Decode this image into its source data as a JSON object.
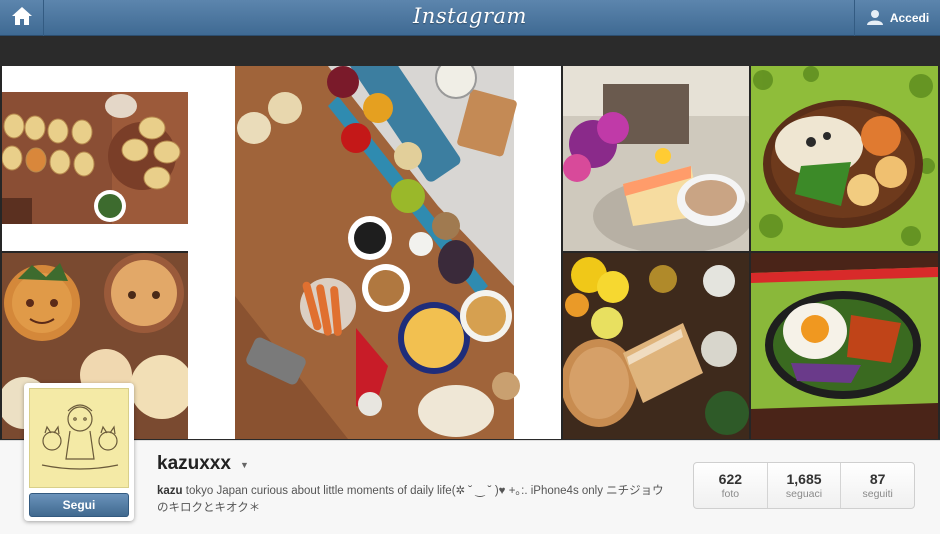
{
  "topbar": {
    "logo": "Instagram",
    "login_label": "Accedi",
    "home_icon": "home-icon",
    "user_icon": "user-icon"
  },
  "photos": [
    {
      "name": "photo-cookies"
    },
    {
      "name": "photo-vegetables-tray"
    },
    {
      "name": "photo-cake-flowers"
    },
    {
      "name": "photo-bento-rice"
    },
    {
      "name": "photo-faces-bread"
    },
    {
      "name": "photo-bread-flowers"
    },
    {
      "name": "photo-bento-egg"
    }
  ],
  "profile": {
    "username": "kazuxxx",
    "bio_name": "kazu",
    "bio_text": " tokyo Japan curious about little moments of daily life(✲ ˘ ‿ ˘ )♥ +｡:. iPhone4s only ニチジョウのキロクとキオク＊",
    "follow_label": "Segui"
  },
  "stats": [
    {
      "value": "622",
      "label": "foto"
    },
    {
      "value": "1,685",
      "label": "seguaci"
    },
    {
      "value": "87",
      "label": "seguiti"
    }
  ],
  "colors": {
    "bar": "#4a75a0",
    "button": "#4f78a1"
  }
}
